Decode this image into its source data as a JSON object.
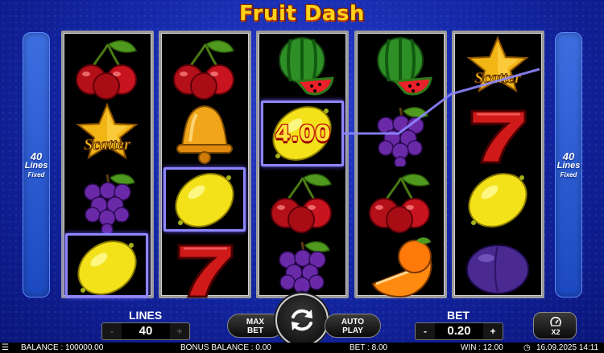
{
  "game": {
    "title": "Fruit Dash",
    "side_panel": {
      "lines": "40",
      "lines_word": "Lines",
      "mode": "Fixed"
    }
  },
  "reels": [
    [
      "cherries",
      "star-scatter",
      "grapes",
      "lemon"
    ],
    [
      "cherries",
      "bell",
      "lemon",
      "seven"
    ],
    [
      "watermelon",
      "lemon",
      "cherries",
      "grapes"
    ],
    [
      "watermelon",
      "grapes",
      "cherries",
      "orange"
    ],
    [
      "star-scatter",
      "seven",
      "lemon",
      "plum"
    ]
  ],
  "symbol_text": {
    "scatter": "Scatter"
  },
  "win": {
    "amount": "4.00"
  },
  "controls": {
    "lines": {
      "label": "LINES",
      "value": "40",
      "minus": "-",
      "plus": "+"
    },
    "max_bet": {
      "line1": "MAX",
      "line2": "BET"
    },
    "spin": {
      "icon": "spin-arrows-icon"
    },
    "auto_play": {
      "line1": "AUTO",
      "line2": "PLAY"
    },
    "bet": {
      "label": "BET",
      "value": "0.20",
      "minus": "-",
      "plus": "+"
    },
    "speed": {
      "label": "X2",
      "icon": "speed-icon"
    }
  },
  "status": {
    "menu_icon": "menu-icon",
    "balance": "BALANCE : 100000.00",
    "bonus_balance": "BONUS BALANCE : 0.00",
    "bet": "BET : 8.00",
    "win": "WIN : 12.00",
    "datetime": "16.09.2025 14:11",
    "clock_icon": "clock-icon"
  },
  "colors": {
    "background": "#1428a8",
    "highlight": "#8d86ff",
    "title": "#ffd21a",
    "win_text": "#ffe23a"
  }
}
